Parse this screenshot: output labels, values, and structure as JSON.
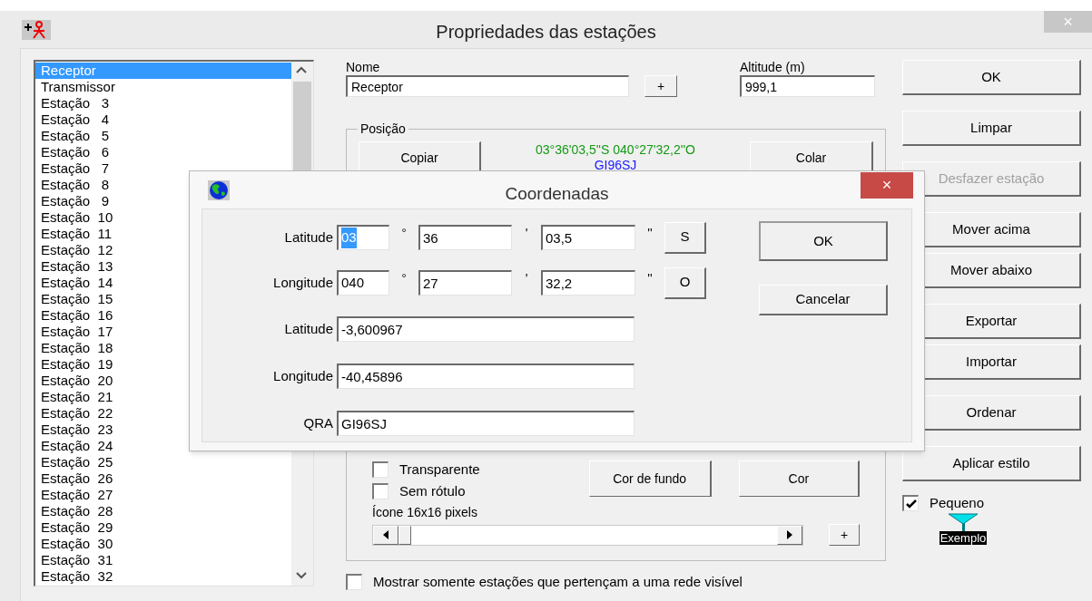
{
  "window": {
    "title": "Propriedades das estações",
    "close": "×"
  },
  "stations": [
    {
      "label": "Receptor",
      "selected": true
    },
    {
      "label": "Transmissor",
      "selected": false
    },
    {
      "label": "Estação   3",
      "selected": false
    },
    {
      "label": "Estação   4",
      "selected": false
    },
    {
      "label": "Estação   5",
      "selected": false
    },
    {
      "label": "Estação   6",
      "selected": false
    },
    {
      "label": "Estação   7",
      "selected": false
    },
    {
      "label": "Estação   8",
      "selected": false
    },
    {
      "label": "Estação   9",
      "selected": false
    },
    {
      "label": "Estação  10",
      "selected": false
    },
    {
      "label": "Estação  11",
      "selected": false
    },
    {
      "label": "Estação  12",
      "selected": false
    },
    {
      "label": "Estação  13",
      "selected": false
    },
    {
      "label": "Estação  14",
      "selected": false
    },
    {
      "label": "Estação  15",
      "selected": false
    },
    {
      "label": "Estação  16",
      "selected": false
    },
    {
      "label": "Estação  17",
      "selected": false
    },
    {
      "label": "Estação  18",
      "selected": false
    },
    {
      "label": "Estação  19",
      "selected": false
    },
    {
      "label": "Estação  20",
      "selected": false
    },
    {
      "label": "Estação  21",
      "selected": false
    },
    {
      "label": "Estação  22",
      "selected": false
    },
    {
      "label": "Estação  23",
      "selected": false
    },
    {
      "label": "Estação  24",
      "selected": false
    },
    {
      "label": "Estação  25",
      "selected": false
    },
    {
      "label": "Estação  26",
      "selected": false
    },
    {
      "label": "Estação  27",
      "selected": false
    },
    {
      "label": "Estação  28",
      "selected": false
    },
    {
      "label": "Estação  29",
      "selected": false
    },
    {
      "label": "Estação  30",
      "selected": false
    },
    {
      "label": "Estação  31",
      "selected": false
    },
    {
      "label": "Estação  32",
      "selected": false
    }
  ],
  "name_field": {
    "label": "Nome",
    "value": "Receptor"
  },
  "add_name_button": "+",
  "altitude_field": {
    "label": "Altitude (m)",
    "value": "999,1"
  },
  "position": {
    "title": "Posição",
    "copy_button": "Copiar",
    "coordinates": "03°36'03,5''S 040°27'32,2''O",
    "qra": "GI96SJ",
    "paste_button": "Colar"
  },
  "style": {
    "checkboxes": [
      {
        "label": "Transparente",
        "checked": false
      },
      {
        "label": "Sem rótulo",
        "checked": false
      }
    ],
    "background_button": "Cor de fundo",
    "color_button": "Cor",
    "icon_label": "Ícone 16x16 pixels",
    "add_button": "+"
  },
  "visible_network_checkbox": {
    "label": "Mostrar somente estações que pertençam a uma rede visível",
    "checked": false
  },
  "action_groups": [
    {
      "buttons": [
        {
          "label": "OK",
          "disabled": false
        }
      ]
    },
    {
      "buttons": [
        {
          "label": "Limpar",
          "disabled": false
        }
      ]
    },
    {
      "buttons": [
        {
          "label": "Desfazer estação",
          "disabled": true
        }
      ]
    },
    {
      "buttons": [
        {
          "label": "Mover acima",
          "disabled": false
        },
        {
          "label": "Mover abaixo",
          "disabled": false
        }
      ]
    },
    {
      "buttons": [
        {
          "label": "Exportar",
          "disabled": false
        },
        {
          "label": "Importar",
          "disabled": false
        }
      ]
    },
    {
      "buttons": [
        {
          "label": "Ordenar",
          "disabled": false
        }
      ]
    },
    {
      "buttons": [
        {
          "label": "Aplicar estilo",
          "disabled": false
        }
      ]
    }
  ],
  "small_checkbox": {
    "label": "Pequeno",
    "checked": true
  },
  "example_label": "Exemplo",
  "dialog": {
    "title": "Coordenadas",
    "close": "×",
    "dms_rows": [
      {
        "label": "Latitude",
        "degrees": "03",
        "degrees_selected": true,
        "degree_mark": "°",
        "minutes": "36",
        "minute_mark": "'",
        "seconds": "03,5",
        "second_mark": "''",
        "hemisphere": "S"
      },
      {
        "label": "Longitude",
        "degrees": "040",
        "degrees_selected": false,
        "degree_mark": "°",
        "minutes": "27",
        "minute_mark": "'",
        "seconds": "32,2",
        "second_mark": "''",
        "hemisphere": "O"
      }
    ],
    "fields": [
      {
        "label": "Latitude",
        "value": "-3,600967"
      },
      {
        "label": "Longitude",
        "value": "-40,45896"
      },
      {
        "label": "QRA",
        "value": "GI96SJ"
      }
    ],
    "ok_button": "OK",
    "cancel_button": "Cancelar"
  }
}
